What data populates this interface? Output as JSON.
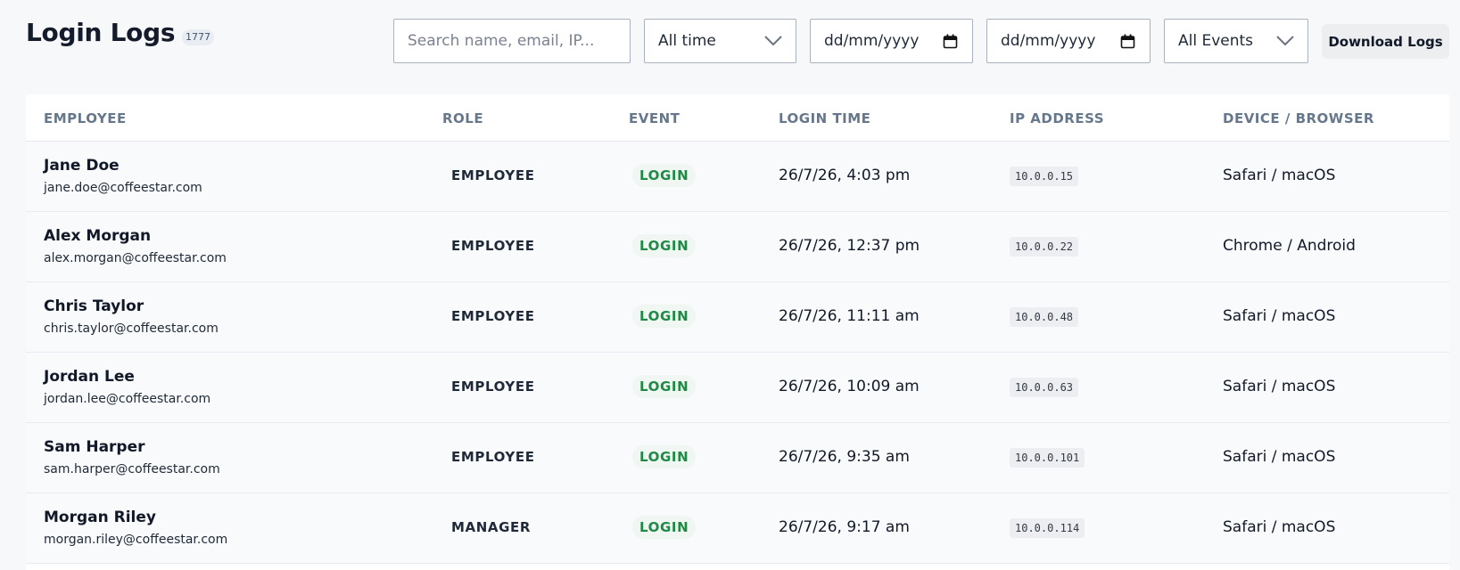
{
  "header": {
    "title": "Login Logs",
    "count": "1777",
    "search_placeholder": "Search name, email, IP...",
    "range_value": "All time",
    "date_from_placeholder": "dd/mm/yyyy",
    "date_to_placeholder": "dd/mm/yyyy",
    "event_filter_value": "All Events",
    "download_label": "Download Logs"
  },
  "table": {
    "columns": [
      "EMPLOYEE",
      "ROLE",
      "EVENT",
      "LOGIN TIME",
      "IP ADDRESS",
      "DEVICE / BROWSER"
    ],
    "rows": [
      {
        "name": "Jane Doe",
        "email": "jane.doe@coffeestar.com",
        "role": "EMPLOYEE",
        "event": "LOGIN",
        "time": "26/7/26, 4:03 pm",
        "ip": "10.0.0.15",
        "device": "Safari / macOS"
      },
      {
        "name": "Alex Morgan",
        "email": "alex.morgan@coffeestar.com",
        "role": "EMPLOYEE",
        "event": "LOGIN",
        "time": "26/7/26, 12:37 pm",
        "ip": "10.0.0.22",
        "device": "Chrome / Android"
      },
      {
        "name": "Chris Taylor",
        "email": "chris.taylor@coffeestar.com",
        "role": "EMPLOYEE",
        "event": "LOGIN",
        "time": "26/7/26, 11:11 am",
        "ip": "10.0.0.48",
        "device": "Safari / macOS"
      },
      {
        "name": "Jordan Lee",
        "email": "jordan.lee@coffeestar.com",
        "role": "EMPLOYEE",
        "event": "LOGIN",
        "time": "26/7/26, 10:09 am",
        "ip": "10.0.0.63",
        "device": "Safari / macOS"
      },
      {
        "name": "Sam Harper",
        "email": "sam.harper@coffeestar.com",
        "role": "EMPLOYEE",
        "event": "LOGIN",
        "time": "26/7/26, 9:35 am",
        "ip": "10.0.0.101",
        "device": "Safari / macOS"
      },
      {
        "name": "Morgan Riley",
        "email": "morgan.riley@coffeestar.com",
        "role": "MANAGER",
        "event": "LOGIN",
        "time": "26/7/26, 9:17 am",
        "ip": "10.0.0.114",
        "device": "Safari / macOS"
      }
    ]
  },
  "colors": {
    "page_background": "#f6f8fa",
    "event_login": "#1f8a46",
    "header_text": "#66778c"
  },
  "icons": {
    "select": "chevron-down-icon",
    "date": "calendar-icon"
  }
}
